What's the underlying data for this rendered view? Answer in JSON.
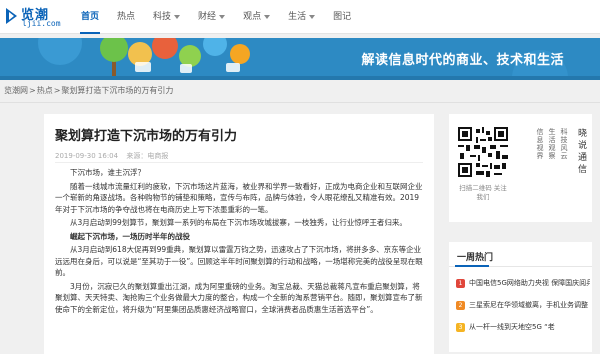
{
  "site": {
    "logo_text": "览潮",
    "logo_domain": "ljii.com"
  },
  "nav": [
    {
      "label": "首页",
      "active": true,
      "dropdown": false
    },
    {
      "label": "热点",
      "active": false,
      "dropdown": false
    },
    {
      "label": "科技",
      "active": false,
      "dropdown": true
    },
    {
      "label": "财经",
      "active": false,
      "dropdown": true
    },
    {
      "label": "观点",
      "active": false,
      "dropdown": true
    },
    {
      "label": "生活",
      "active": false,
      "dropdown": true
    },
    {
      "label": "图记",
      "active": false,
      "dropdown": false
    }
  ],
  "banner": {
    "slogan": "解读信息时代的商业、技术和生活"
  },
  "breadcrumb": [
    "览潮网",
    "热点",
    "聚划算打造下沉市场的万有引力"
  ],
  "article": {
    "title": "聚划算打造下沉市场的万有引力",
    "date": "2019-09-30 16:04",
    "source": "来源：电商报",
    "paragraphs": [
      {
        "text": "下沉市场，谁主沉浮？",
        "bold": false
      },
      {
        "text": "随着一线城市流量红利的疲软，下沉市场这片蓝海，被业界和学界一致看好，正成为电商企业和互联网企业一个崭新的角逐战场。各种购物节的铺垫和策略，宣传与布阵，品牌与体验，令人眼花缭乱又精准有效。2019年对于下沉市场的争夺战也将在电商历史上写下浓墨重彩的一笔。",
        "bold": false
      },
      {
        "text": "从3月启动到99划算节，聚划算一系列的布局在下沉市场攻城拔寨，一枝独秀，让行业惊呼王者归来。",
        "bold": false
      },
      {
        "text": "崛起下沉市场，一场历时半年的战役",
        "bold": true
      },
      {
        "text": "从3月启动到618大促再到99重典，聚划算以雷霆万钧之势，迅速攻占了下沉市场，将拼多多、京东等企业远远甩在身后，可以说是“至其功于一役”。回顾这半年时间聚划算的行动和战略，一场堪称完美的战役呈现在眼前。",
        "bold": false
      },
      {
        "text": "3月份，沉寂已久的聚划算重出江湖，成为阿里重磅的业务。淘宝总裁、天猫总裁蒋凡宣布重启聚划算，将聚划算、天天特卖、淘抢购三个业务做最大力度的整合，构成一个全新的淘系营销平台。随即，聚划算宣布了新使命下的全新定位，将升级为“阿里集团品质惠经济战略窗口，全球消费者品质惠生活首选平台”。",
        "bold": false
      }
    ]
  },
  "sidebar": {
    "qr_caption": "扫描二维码 关注我们",
    "vertical_columns": [
      "晓说通信",
      "科技风云",
      "生活观察",
      "信息视界"
    ],
    "hot": {
      "heading": "一周热门",
      "items": [
        {
          "rank": "1",
          "text": "中国电信5G网络助力央视 保障国庆阅兵"
        },
        {
          "rank": "2",
          "text": "三星索尼在华领域撤离，手机业务调整"
        },
        {
          "rank": "3",
          "text": "从一杆一线到天地空5G “老"
        }
      ]
    }
  },
  "colors": {
    "brand": "#0a63b8",
    "banner_bg": "#2d8ac3",
    "hot_rank_1": "#e0463b",
    "hot_rank_2": "#f08a24",
    "hot_rank_3": "#f5b423"
  }
}
